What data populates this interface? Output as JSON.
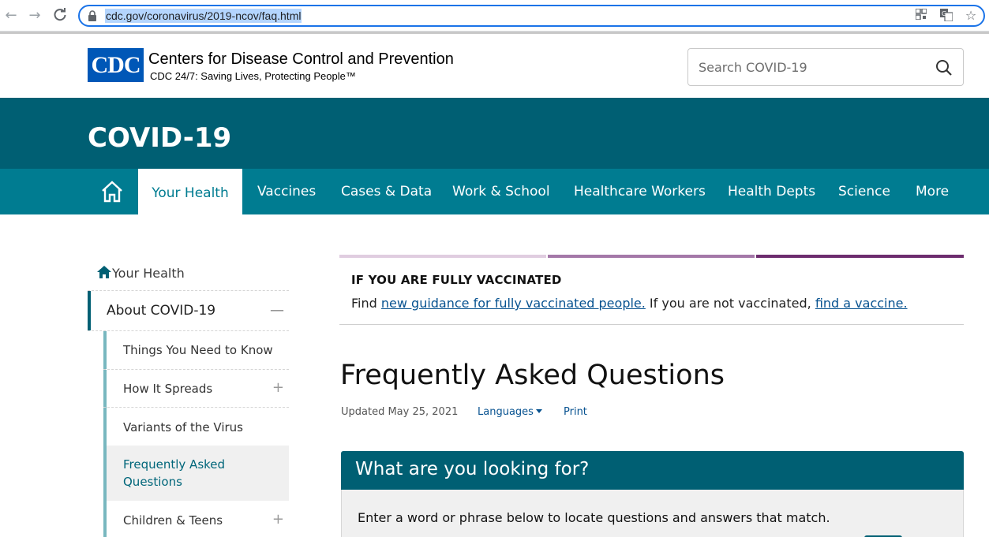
{
  "browser": {
    "url": "cdc.gov/coronavirus/2019-ncov/faq.html",
    "icons": [
      "back-arrow-icon",
      "forward-arrow-icon",
      "reload-icon",
      "lock-icon",
      "qr-code-icon",
      "translate-icon",
      "bookmark-star-icon"
    ]
  },
  "header": {
    "logo_text": "CDC",
    "org_name": "Centers for Disease Control and Prevention",
    "tagline": "CDC 24/7: Saving Lives, Protecting People™",
    "search_placeholder": "Search COVID-19"
  },
  "banner": {
    "title": "COVID-19"
  },
  "topnav": {
    "items": [
      {
        "label": "Your Health",
        "active": true
      },
      {
        "label": "Vaccines"
      },
      {
        "label": "Cases & Data"
      },
      {
        "label": "Work & School"
      },
      {
        "label": "Healthcare Workers"
      },
      {
        "label": "Health Depts"
      },
      {
        "label": "Science"
      },
      {
        "label": "More"
      }
    ]
  },
  "leftnav": {
    "heading": "Your Health",
    "section": "About COVID-19",
    "items": [
      {
        "label": "Things You Need to Know"
      },
      {
        "label": "How It Spreads",
        "expandable": true
      },
      {
        "label": "Variants of the Virus"
      },
      {
        "label": "Frequently Asked Questions",
        "selected": true
      },
      {
        "label": "Children & Teens",
        "expandable": true
      }
    ]
  },
  "alert": {
    "title": "IF YOU ARE FULLY VACCINATED",
    "text_1": "Find ",
    "link_1": "new guidance for fully vaccinated people.",
    "text_2": " If you are not vaccinated, ",
    "link_2": "find a vaccine.",
    "colors": [
      "#e0cde0",
      "#a478a8",
      "#6d2c6e"
    ]
  },
  "page": {
    "title": "Frequently Asked Questions",
    "updated": "Updated May 25, 2021",
    "languages": "Languages",
    "print": "Print"
  },
  "search_panel": {
    "title": "What are you looking for?",
    "instructions": "Enter a word or phrase below to locate questions and answers that match."
  },
  "colors": {
    "banner": "#005f73",
    "nav": "#007c91",
    "link": "#075290"
  }
}
